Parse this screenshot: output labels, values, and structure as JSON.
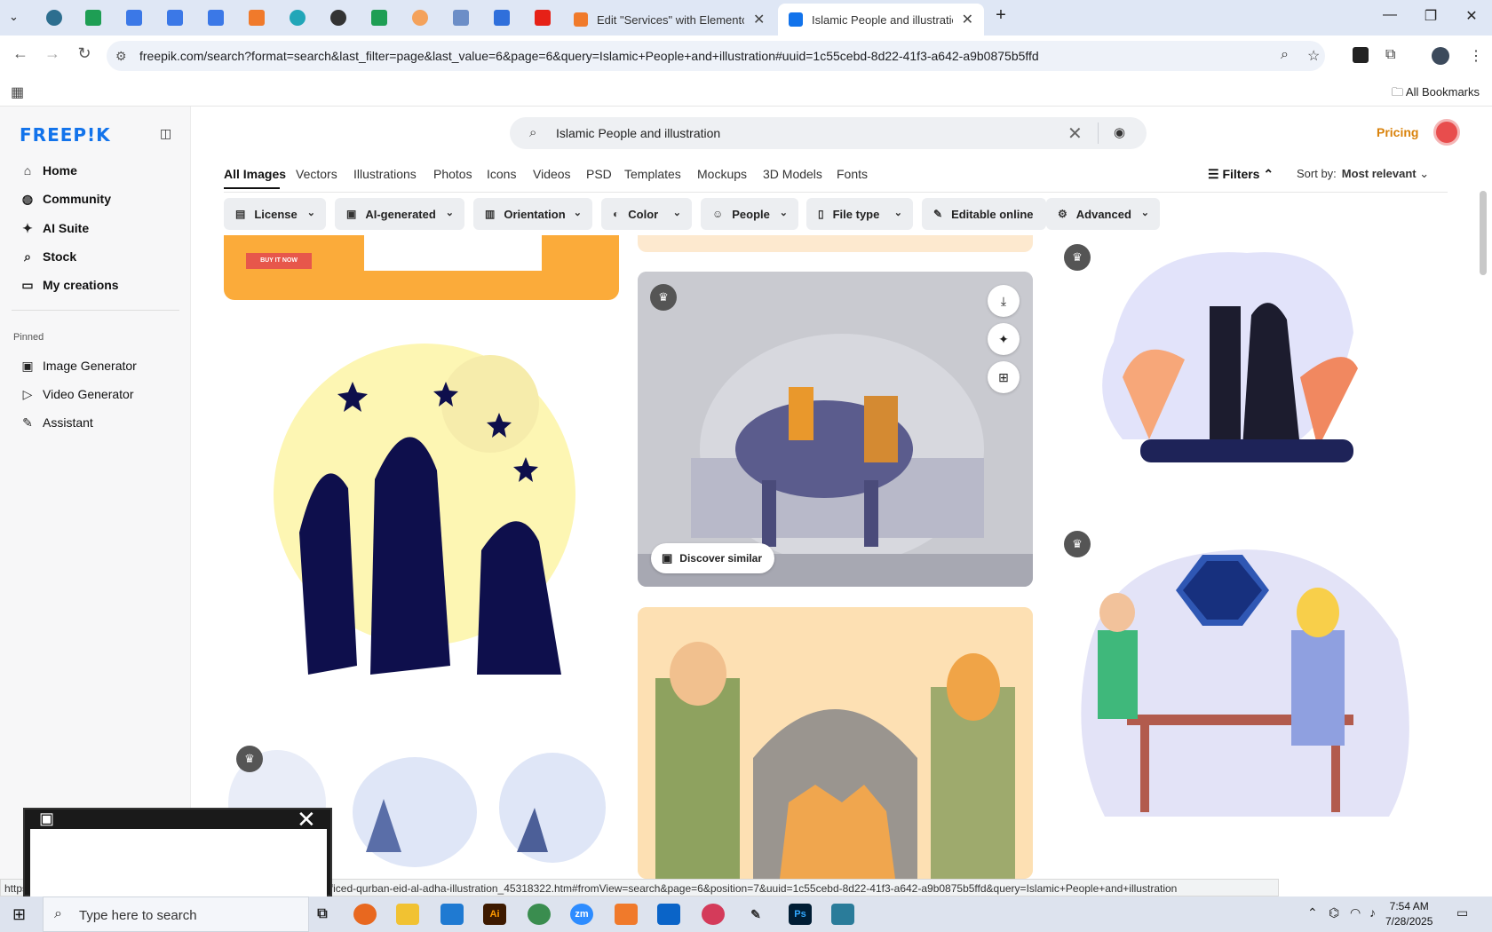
{
  "browser": {
    "tabs": [
      {
        "title": "Edit \"Services\" with Elementor",
        "close": "✕"
      },
      {
        "title": "Islamic People and illustration v",
        "close": "✕"
      }
    ],
    "new_tab": "+",
    "url": "freepik.com/search?format=search&last_filter=page&last_value=6&page=6&query=Islamic+People+and+illustration#uuid=1c55cebd-8d22-41f3-a642-a9b0875b5ffd",
    "all_bookmarks": "All Bookmarks"
  },
  "sidebar": {
    "logo": "FREEP!K",
    "items": [
      {
        "label": "Home",
        "icon": "home-icon",
        "glyph": "⌂"
      },
      {
        "label": "Community",
        "icon": "globe-icon",
        "glyph": "◍"
      },
      {
        "label": "AI Suite",
        "icon": "sparkle-icon",
        "glyph": "✦"
      },
      {
        "label": "Stock",
        "icon": "search-icon",
        "glyph": "⌕"
      },
      {
        "label": "My creations",
        "icon": "folder-icon",
        "glyph": "▭"
      }
    ],
    "pinned_heading": "Pinned",
    "pinned": [
      {
        "label": "Image Generator",
        "icon": "image-icon",
        "glyph": "▣"
      },
      {
        "label": "Video Generator",
        "icon": "video-icon",
        "glyph": "▷"
      },
      {
        "label": "Assistant",
        "icon": "chat-icon",
        "glyph": "✎"
      }
    ]
  },
  "search": {
    "query": "Islamic People and illustration",
    "clear": "✕"
  },
  "header": {
    "pricing": "Pricing"
  },
  "categories": [
    "All Images",
    "Vectors",
    "Illustrations",
    "Photos",
    "Icons",
    "Videos",
    "PSD",
    "Templates",
    "Mockups",
    "3D Models",
    "Fonts"
  ],
  "filters_label": "Filters",
  "sort": {
    "label": "Sort by:",
    "value": "Most relevant"
  },
  "chips": [
    "License",
    "AI-generated",
    "Orientation",
    "Color",
    "People",
    "File type",
    "Editable online",
    "Advanced"
  ],
  "cards": {
    "banner_button": "BUY IT NOW",
    "discover_similar": "Discover similar"
  },
  "statusbar": "https://www.freepik.com/free-vector/flat-illustration-of-cow-being-sacrificed-qurban-eid-al-adha-illustration_45318322.htm#fromView=search&page=6&position=7&uuid=1c55cebd-8d22-41f3-a642-a9b0875b5ffd&query=Islamic+People+and+illustration",
  "taskbar": {
    "search_placeholder": "Type here to search",
    "time": "7:54 AM",
    "date": "7/28/2025"
  },
  "colors": {
    "brand": "#1273eb",
    "pricing": "#d9820b",
    "banner": "#fbab3a"
  }
}
